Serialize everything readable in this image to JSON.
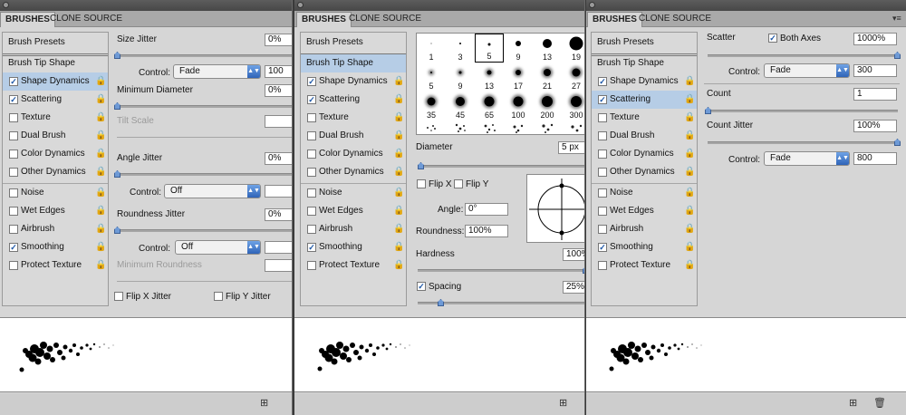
{
  "panel1": {
    "tabs": [
      "BRUSHES",
      "CLONE SOURCE"
    ],
    "sidebar": [
      {
        "label": "Brush Presets",
        "checked": null,
        "lock": false
      },
      {
        "label": "Brush Tip Shape",
        "checked": null,
        "lock": false
      },
      {
        "label": "Shape Dynamics",
        "checked": true,
        "lock": true
      },
      {
        "label": "Scattering",
        "checked": true,
        "lock": true
      },
      {
        "label": "Texture",
        "checked": false,
        "lock": true
      },
      {
        "label": "Dual Brush",
        "checked": false,
        "lock": true
      },
      {
        "label": "Color Dynamics",
        "checked": false,
        "lock": true
      },
      {
        "label": "Other Dynamics",
        "checked": false,
        "lock": true
      },
      {
        "label": "Noise",
        "checked": false,
        "lock": true
      },
      {
        "label": "Wet Edges",
        "checked": false,
        "lock": true
      },
      {
        "label": "Airbrush",
        "checked": false,
        "lock": true
      },
      {
        "label": "Smoothing",
        "checked": true,
        "lock": true
      },
      {
        "label": "Protect Texture",
        "checked": false,
        "lock": true
      }
    ],
    "size_jitter_label": "Size Jitter",
    "size_jitter_value": "0%",
    "control1_label": "Control:",
    "control1_value": "Fade",
    "control1_field": "100",
    "min_diameter_label": "Minimum Diameter",
    "min_diameter_value": "0%",
    "tilt_scale_label": "Tilt Scale",
    "angle_jitter_label": "Angle Jitter",
    "angle_jitter_value": "0%",
    "control2_label": "Control:",
    "control2_value": "Off",
    "roundness_jitter_label": "Roundness Jitter",
    "roundness_jitter_value": "0%",
    "control3_label": "Control:",
    "control3_value": "Off",
    "min_roundness_label": "Minimum Roundness",
    "flip_x_label": "Flip X Jitter",
    "flip_y_label": "Flip Y Jitter"
  },
  "panel2": {
    "tabs": [
      "BRUSHES",
      "CLONE SOURCE"
    ],
    "sidebar": [
      {
        "label": "Brush Presets",
        "checked": null,
        "lock": false
      },
      {
        "label": "Brush Tip Shape",
        "checked": null,
        "lock": false
      },
      {
        "label": "Shape Dynamics",
        "checked": true,
        "lock": true
      },
      {
        "label": "Scattering",
        "checked": true,
        "lock": true
      },
      {
        "label": "Texture",
        "checked": false,
        "lock": true
      },
      {
        "label": "Dual Brush",
        "checked": false,
        "lock": true
      },
      {
        "label": "Color Dynamics",
        "checked": false,
        "lock": true
      },
      {
        "label": "Other Dynamics",
        "checked": false,
        "lock": true
      },
      {
        "label": "Noise",
        "checked": false,
        "lock": true
      },
      {
        "label": "Wet Edges",
        "checked": false,
        "lock": true
      },
      {
        "label": "Airbrush",
        "checked": false,
        "lock": true
      },
      {
        "label": "Smoothing",
        "checked": true,
        "lock": true
      },
      {
        "label": "Protect Texture",
        "checked": false,
        "lock": true
      }
    ],
    "brush_sizes": [
      "1",
      "3",
      "5",
      "9",
      "13",
      "19",
      "5",
      "9",
      "13",
      "17",
      "21",
      "27",
      "35",
      "45",
      "65",
      "100",
      "200",
      "300"
    ],
    "selected_brush": "5",
    "diameter_label": "Diameter",
    "diameter_value": "5 px",
    "flip_x_label": "Flip X",
    "flip_y_label": "Flip Y",
    "angle_label": "Angle:",
    "angle_value": "0°",
    "roundness_label": "Roundness:",
    "roundness_value": "100%",
    "hardness_label": "Hardness",
    "hardness_value": "100%",
    "spacing_label": "Spacing",
    "spacing_value": "25%"
  },
  "panel3": {
    "tabs": [
      "BRUSHES",
      "CLONE SOURCE"
    ],
    "sidebar": [
      {
        "label": "Brush Presets",
        "checked": null,
        "lock": false
      },
      {
        "label": "Brush Tip Shape",
        "checked": null,
        "lock": false
      },
      {
        "label": "Shape Dynamics",
        "checked": true,
        "lock": true
      },
      {
        "label": "Scattering",
        "checked": true,
        "lock": true
      },
      {
        "label": "Texture",
        "checked": false,
        "lock": true
      },
      {
        "label": "Dual Brush",
        "checked": false,
        "lock": true
      },
      {
        "label": "Color Dynamics",
        "checked": false,
        "lock": true
      },
      {
        "label": "Other Dynamics",
        "checked": false,
        "lock": true
      },
      {
        "label": "Noise",
        "checked": false,
        "lock": true
      },
      {
        "label": "Wet Edges",
        "checked": false,
        "lock": true
      },
      {
        "label": "Airbrush",
        "checked": false,
        "lock": true
      },
      {
        "label": "Smoothing",
        "checked": true,
        "lock": true
      },
      {
        "label": "Protect Texture",
        "checked": false,
        "lock": true
      }
    ],
    "scatter_label": "Scatter",
    "both_axes_label": "Both Axes",
    "scatter_value": "1000%",
    "control1_label": "Control:",
    "control1_value": "Fade",
    "control1_field": "300",
    "count_label": "Count",
    "count_value": "1",
    "count_jitter_label": "Count Jitter",
    "count_jitter_value": "100%",
    "control2_label": "Control:",
    "control2_value": "Fade",
    "control2_field": "800"
  },
  "icons": {
    "lock": "lock-icon",
    "new_preset": "new-preset-icon",
    "trash": "trash-icon",
    "panel_menu": "panel-menu-icon"
  }
}
